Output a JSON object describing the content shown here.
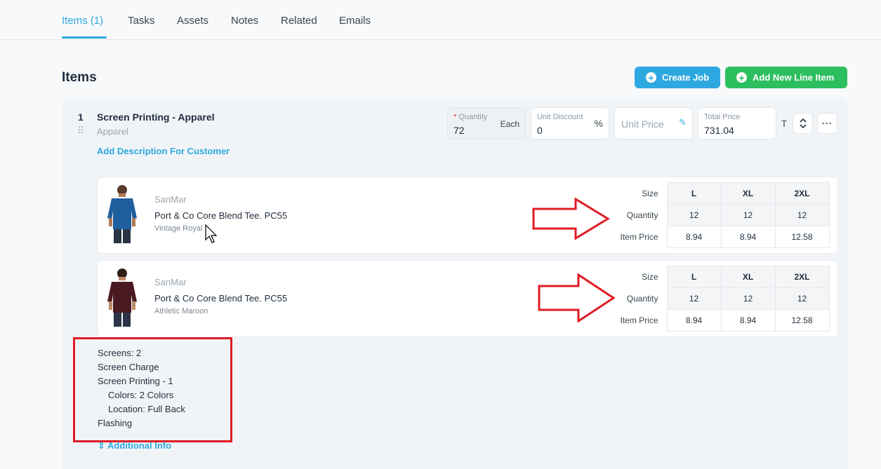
{
  "tabs": [
    {
      "label": "Items (1)",
      "active": true
    },
    {
      "label": "Tasks"
    },
    {
      "label": "Assets"
    },
    {
      "label": "Notes"
    },
    {
      "label": "Related"
    },
    {
      "label": "Emails"
    }
  ],
  "header": {
    "title": "Items",
    "create_job_label": "Create Job",
    "add_line_item_label": "Add New Line Item"
  },
  "line_item": {
    "number": "1",
    "title": "Screen Printing - Apparel",
    "subtitle": "Apparel",
    "add_description_link": "Add Description For Customer",
    "quantity": {
      "required_mark": "*",
      "label": "Quantity",
      "value": "72",
      "unit": "Each"
    },
    "unit_discount": {
      "label": "Unit Discount",
      "value": "0",
      "suffix": "%"
    },
    "unit_price": {
      "placeholder": "Unit Price"
    },
    "total_price": {
      "label": "Total Price",
      "value": "731.04"
    },
    "tax_label": "T"
  },
  "products": [
    {
      "brand": "SanMar",
      "name": "Port & Co Core Blend Tee. PC55",
      "color": "Vintage Royal",
      "row_labels": [
        "Size",
        "Quantity",
        "Item Price"
      ],
      "sizes": [
        "L",
        "XL",
        "2XL"
      ],
      "quantities": [
        "12",
        "12",
        "12"
      ],
      "prices": [
        "8.94",
        "8.94",
        "12.58"
      ]
    },
    {
      "brand": "SanMar",
      "name": "Port & Co Core Blend Tee. PC55",
      "color": "Athletic Maroon",
      "row_labels": [
        "Size",
        "Quantity",
        "Item Price"
      ],
      "sizes": [
        "L",
        "XL",
        "2XL"
      ],
      "quantities": [
        "12",
        "12",
        "12"
      ],
      "prices": [
        "8.94",
        "8.94",
        "12.58"
      ]
    }
  ],
  "notes": {
    "lines": [
      "Screens: 2",
      "Screen Charge",
      "Screen Printing - 1",
      "Colors: 2 Colors",
      "Location: Full Back",
      "Flashing"
    ]
  },
  "additional_info_label": "Additional Info",
  "colors": {
    "accent": "#2ea8e0",
    "green": "#2dbf5f",
    "annotation_red": "#e01b24",
    "shirt_royal": "#1f5f9e",
    "shirt_maroon": "#4a1a22"
  }
}
